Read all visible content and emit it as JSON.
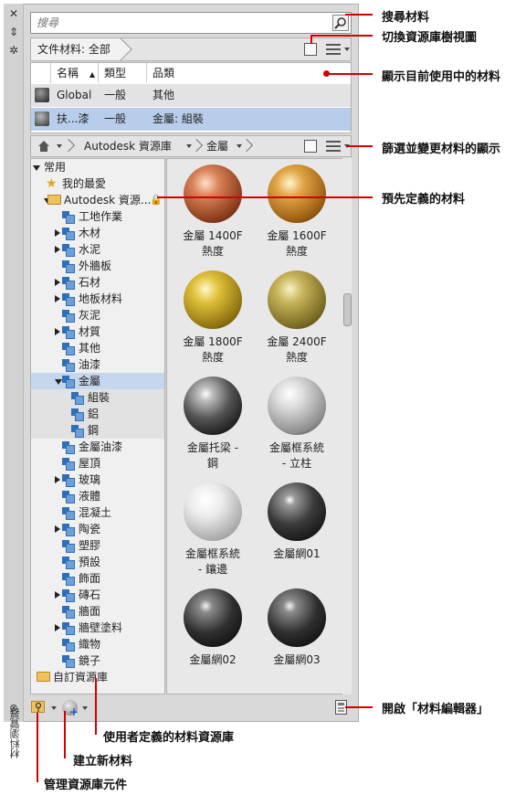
{
  "palette": {
    "title": "材料瀏覽器",
    "search": {
      "placeholder": "搜尋",
      "value": ""
    },
    "doc_materials": {
      "label": "文件材料: 全部"
    },
    "table": {
      "columns": [
        "名稱",
        "類型",
        "品類"
      ],
      "sort_indicator": "▲",
      "rows": [
        {
          "name": "Global",
          "type": "一般",
          "category": "其他",
          "selected": false
        },
        {
          "name": "扶...漆",
          "type": "一般",
          "category": "金屬: 組裝",
          "selected": true
        }
      ]
    },
    "browser": {
      "breadcrumb": [
        "Autodesk 資源庫",
        "金屬"
      ],
      "tree": [
        {
          "label": "常用",
          "level": 0,
          "expander": "open",
          "icon": "none"
        },
        {
          "label": "我的最愛",
          "level": 1,
          "expander": "none",
          "icon": "star-icon"
        },
        {
          "label": "Autodesk 資源...",
          "level": 1,
          "expander": "open",
          "icon": "folder-icon",
          "locked": true
        },
        {
          "label": "工地作業",
          "level": 2,
          "expander": "none",
          "icon": "library-icon"
        },
        {
          "label": "木材",
          "level": 2,
          "expander": "closed",
          "icon": "library-icon"
        },
        {
          "label": "水泥",
          "level": 2,
          "expander": "closed",
          "icon": "library-icon"
        },
        {
          "label": "外牆板",
          "level": 2,
          "expander": "none",
          "icon": "library-icon"
        },
        {
          "label": "石材",
          "level": 2,
          "expander": "closed",
          "icon": "library-icon"
        },
        {
          "label": "地板材料",
          "level": 2,
          "expander": "closed",
          "icon": "library-icon"
        },
        {
          "label": "灰泥",
          "level": 2,
          "expander": "none",
          "icon": "library-icon"
        },
        {
          "label": "材質",
          "level": 2,
          "expander": "closed",
          "icon": "library-icon"
        },
        {
          "label": "其他",
          "level": 2,
          "expander": "none",
          "icon": "library-icon"
        },
        {
          "label": "油漆",
          "level": 2,
          "expander": "none",
          "icon": "library-icon"
        },
        {
          "label": "金屬",
          "level": 2,
          "expander": "open",
          "icon": "library-icon",
          "selected": true
        },
        {
          "label": "組裝",
          "level": 3,
          "expander": "none",
          "icon": "library-icon",
          "sub": true
        },
        {
          "label": "鋁",
          "level": 3,
          "expander": "none",
          "icon": "library-icon",
          "sub": true
        },
        {
          "label": "鋼",
          "level": 3,
          "expander": "none",
          "icon": "library-icon",
          "sub": true
        },
        {
          "label": "金屬油漆",
          "level": 2,
          "expander": "none",
          "icon": "library-icon"
        },
        {
          "label": "屋頂",
          "level": 2,
          "expander": "none",
          "icon": "library-icon"
        },
        {
          "label": "玻璃",
          "level": 2,
          "expander": "closed",
          "icon": "library-icon"
        },
        {
          "label": "液體",
          "level": 2,
          "expander": "none",
          "icon": "library-icon"
        },
        {
          "label": "混凝土",
          "level": 2,
          "expander": "none",
          "icon": "library-icon"
        },
        {
          "label": "陶瓷",
          "level": 2,
          "expander": "closed",
          "icon": "library-icon"
        },
        {
          "label": "塑膠",
          "level": 2,
          "expander": "none",
          "icon": "library-icon"
        },
        {
          "label": "預設",
          "level": 2,
          "expander": "none",
          "icon": "library-icon"
        },
        {
          "label": "飾面",
          "level": 2,
          "expander": "none",
          "icon": "library-icon"
        },
        {
          "label": "磚石",
          "level": 2,
          "expander": "closed",
          "icon": "library-icon"
        },
        {
          "label": "牆面",
          "level": 2,
          "expander": "none",
          "icon": "library-icon"
        },
        {
          "label": "牆壁塗料",
          "level": 2,
          "expander": "closed",
          "icon": "library-icon"
        },
        {
          "label": "織物",
          "level": 2,
          "expander": "none",
          "icon": "library-icon"
        },
        {
          "label": "鏡子",
          "level": 2,
          "expander": "none",
          "icon": "library-icon"
        },
        {
          "label": "自訂資源庫",
          "level": 0,
          "expander": "none",
          "icon": "folder-icon"
        }
      ],
      "swatches": [
        {
          "line1": "金屬 1400F",
          "line2": "熱度",
          "style": "copper"
        },
        {
          "line1": "金屬 1600F",
          "line2": "熱度",
          "style": "amber"
        },
        {
          "line1": "金屬 1800F",
          "line2": "熱度",
          "style": "gold"
        },
        {
          "line1": "金屬 2400F",
          "line2": "熱度",
          "style": "olive"
        },
        {
          "line1": "金屬托梁 -",
          "line2": "鋼",
          "style": "chrome"
        },
        {
          "line1": "金屬框系統",
          "line2": "- 立柱",
          "style": "silver"
        },
        {
          "line1": "金屬框系統",
          "line2": "- 鑲邊",
          "style": "white"
        },
        {
          "line1": "金屬網01",
          "line2": "",
          "style": "mesh"
        },
        {
          "line1": "金屬網02",
          "line2": "",
          "style": "mesh2"
        },
        {
          "line1": "金屬網03",
          "line2": "",
          "style": "mesh2"
        }
      ]
    }
  },
  "callouts": {
    "search": "搜尋材料",
    "toggle_tree": "切換資源庫樹視圖",
    "in_use": "顯示目前使用中的材料",
    "filter": "篩選並變更材料的顯示",
    "predefined": "預先定義的材料",
    "open_editor": "開啟「材料編輯器」",
    "user_library": "使用者定義的材料資源庫",
    "create_new": "建立新材料",
    "manage_library": "管理資源庫元件"
  },
  "colors": {
    "selection": "#c5d7ee",
    "callout_line": "#d40000"
  }
}
